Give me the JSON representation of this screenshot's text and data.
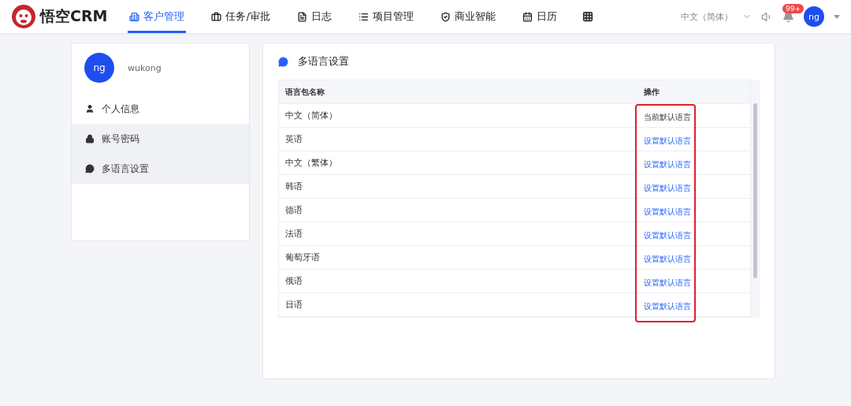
{
  "header": {
    "logo_text": "悟空CRM",
    "nav": [
      {
        "label": "客户管理",
        "selected": true
      },
      {
        "label": "任务/审批",
        "selected": false
      },
      {
        "label": "日志",
        "selected": false
      },
      {
        "label": "项目管理",
        "selected": false
      },
      {
        "label": "商业智能",
        "selected": false
      },
      {
        "label": "日历",
        "selected": false
      }
    ],
    "language": "中文（简体）",
    "notification_badge": "99+",
    "avatar": "ng"
  },
  "sidebar": {
    "avatar": "ng",
    "username": "wukong",
    "items": [
      {
        "label": "个人信息",
        "highlighted": false
      },
      {
        "label": "账号密码",
        "highlighted": true
      },
      {
        "label": "多语言设置",
        "highlighted": true
      }
    ]
  },
  "panel": {
    "title": "多语言设置",
    "columns": [
      "语言包名称",
      "操作"
    ],
    "rows": [
      {
        "name": "中文（简体）",
        "action": "当前默认语言",
        "is_default": true
      },
      {
        "name": "英语",
        "action": "设置默认语言",
        "is_default": false
      },
      {
        "name": "中文（繁体）",
        "action": "设置默认语言",
        "is_default": false
      },
      {
        "name": "韩语",
        "action": "设置默认语言",
        "is_default": false
      },
      {
        "name": "德语",
        "action": "设置默认语言",
        "is_default": false
      },
      {
        "name": "法语",
        "action": "设置默认语言",
        "is_default": false
      },
      {
        "name": "葡萄牙语",
        "action": "设置默认语言",
        "is_default": false
      },
      {
        "name": "俄语",
        "action": "设置默认语言",
        "is_default": false
      },
      {
        "name": "日语",
        "action": "设置默认语言",
        "is_default": false
      }
    ]
  }
}
